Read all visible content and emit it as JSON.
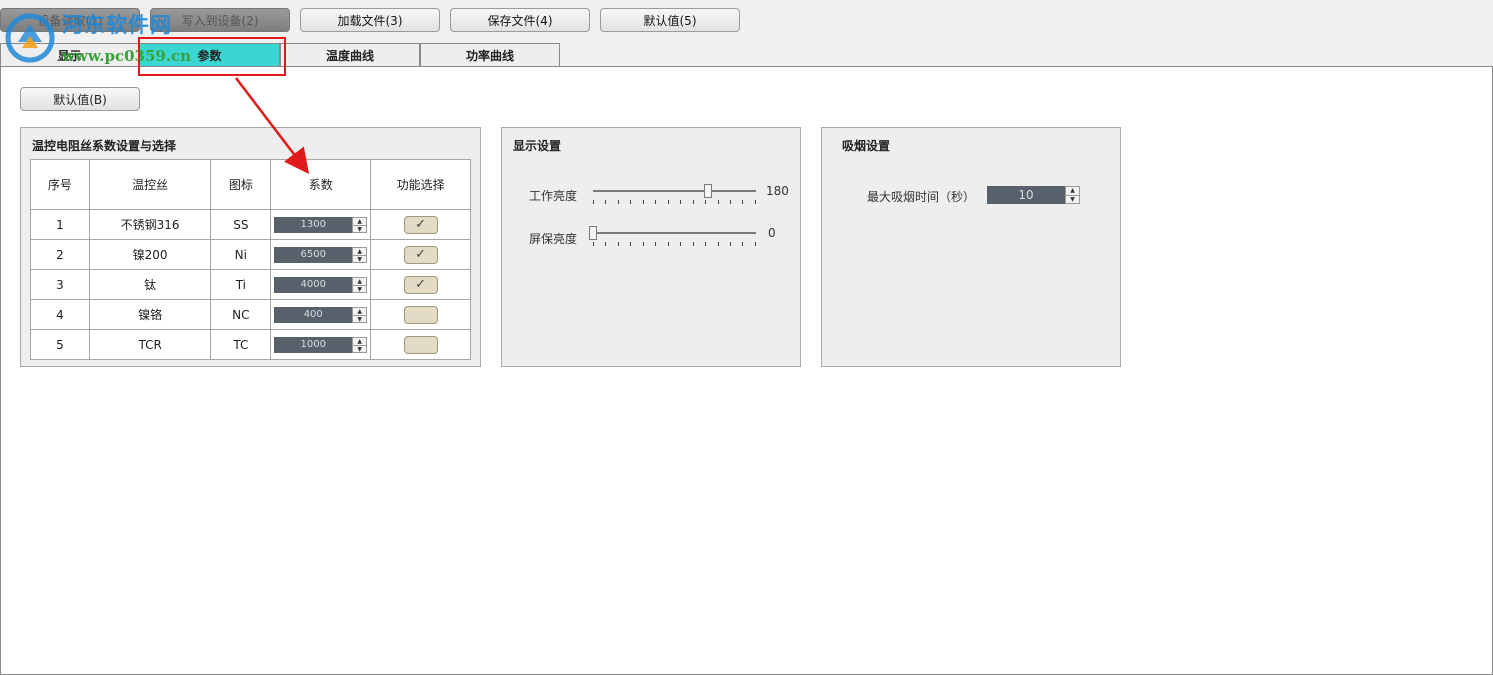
{
  "toolbar": {
    "read_device": "设备读取(1)",
    "write_device": "写入到设备(2)",
    "load_file": "加载文件(3)",
    "save_file": "保存文件(4)",
    "defaults": "默认值(5)"
  },
  "tabs": [
    "显示",
    "参数",
    "温度曲线",
    "功率曲线"
  ],
  "active_tab": "参数",
  "panel": {
    "default_button": "默认值(B)"
  },
  "coef_group": {
    "title": "温控电阻丝系数设置与选择",
    "headers": [
      "序号",
      "温控丝",
      "图标",
      "系数",
      "功能选择"
    ],
    "rows": [
      {
        "index": "1",
        "wire": "不锈钢316",
        "icon": "SS",
        "coef": "1300",
        "checked": true
      },
      {
        "index": "2",
        "wire": "镍200",
        "icon": "Ni",
        "coef": "6500",
        "checked": true
      },
      {
        "index": "3",
        "wire": "钛",
        "icon": "Ti",
        "coef": "4000",
        "checked": true
      },
      {
        "index": "4",
        "wire": "镍铬",
        "icon": "NC",
        "coef": "400",
        "checked": false
      },
      {
        "index": "5",
        "wire": "TCR",
        "icon": "TC",
        "coef": "1000",
        "checked": false
      }
    ]
  },
  "display_group": {
    "title": "显示设置",
    "work_brightness": {
      "label": "工作亮度",
      "value": "180",
      "max": 255
    },
    "screensaver_brightness": {
      "label": "屏保亮度",
      "value": "0",
      "max": 255
    }
  },
  "smoke_group": {
    "title": "吸烟设置",
    "max_time_label": "最大吸烟时间（秒）",
    "max_time_value": "10"
  },
  "watermark": {
    "site_name": "河东软件网",
    "url": "www.pc0359.cn"
  },
  "colors": {
    "active_tab": "#3ad6d4",
    "annotation": "#e01a1a",
    "spin_value_bg": "#58606b",
    "checkbox_bg": "#e2dcc4"
  }
}
